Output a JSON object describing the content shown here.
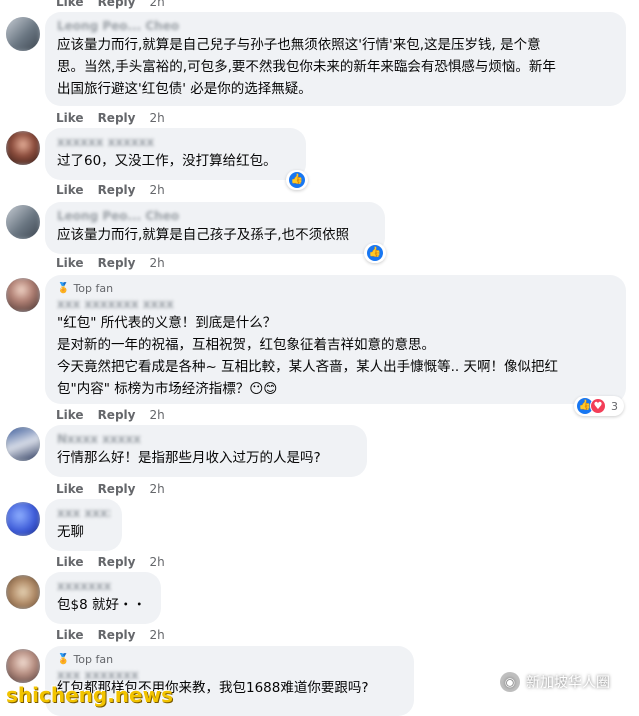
{
  "ui": {
    "like_label": "Like",
    "reply_label": "Reply",
    "top_fan_label": "Top fan",
    "accent_color": "#1877f2",
    "love_color": "#f33e58"
  },
  "top_actions": {
    "like": "Like",
    "reply": "Reply",
    "time": "2h"
  },
  "comments": [
    {
      "name": "Leong Peo... Cheo",
      "text": "应该量力而行,就算是自己兒子与孙子也無须依照这'行情'来包,这是压岁钱, 是个意\n思。当然,手头富裕的,可包多,要不然我包你未来的新年来臨会有恐惧感与烦恼。新年\n出国旅行避这'红包债' 必是你的选择無疑。",
      "time": "2h"
    },
    {
      "name": "xxxxxx xxxxxx",
      "text": "过了60，又没工作，没打算给红包。",
      "time": "2h",
      "reactions": {
        "icons": [
          "like-icon"
        ],
        "count": ""
      }
    },
    {
      "name": "Leong Peo... Cheo",
      "text": "应该量力而行,就算是自己孩子及孫子,也不须依照",
      "time": "2h",
      "reactions": {
        "icons": [
          "like-icon"
        ],
        "count": ""
      }
    },
    {
      "top_fan": true,
      "name": "xxx xxxxxxx xxxx",
      "text": "\"红包\" 所代表的义意！到底是什么？\n是对新的一年的祝福，互相祝贺，红包象征着吉祥如意的意思。\n今天竟然把它看成是各种~ 互相比較，某人吝啬，某人出手慷慨等.. 天啊！像似把红\n包\"内容\" 标榜为市场经济指標？😶😊",
      "time": "2h",
      "reactions": {
        "icons": [
          "like-icon",
          "love-icon"
        ],
        "count": "3"
      }
    },
    {
      "name": "Nxxxx xxxxx",
      "text": "行情那么好！是指那些月收入过万的人是吗?",
      "time": "2h"
    },
    {
      "name": "xxx xxxxx",
      "text": "无聊",
      "time": "2h"
    },
    {
      "name": "xxxxxxx",
      "text": "包$8 就好・・",
      "time": "2h"
    },
    {
      "top_fan": true,
      "name": "xxx xxxxxxx",
      "text": "红包都那样包不用你来教，我包1688难道你要跟吗?"
    }
  ],
  "watermarks": {
    "left": "shicheng.news",
    "right": "新加坡华人圈"
  }
}
